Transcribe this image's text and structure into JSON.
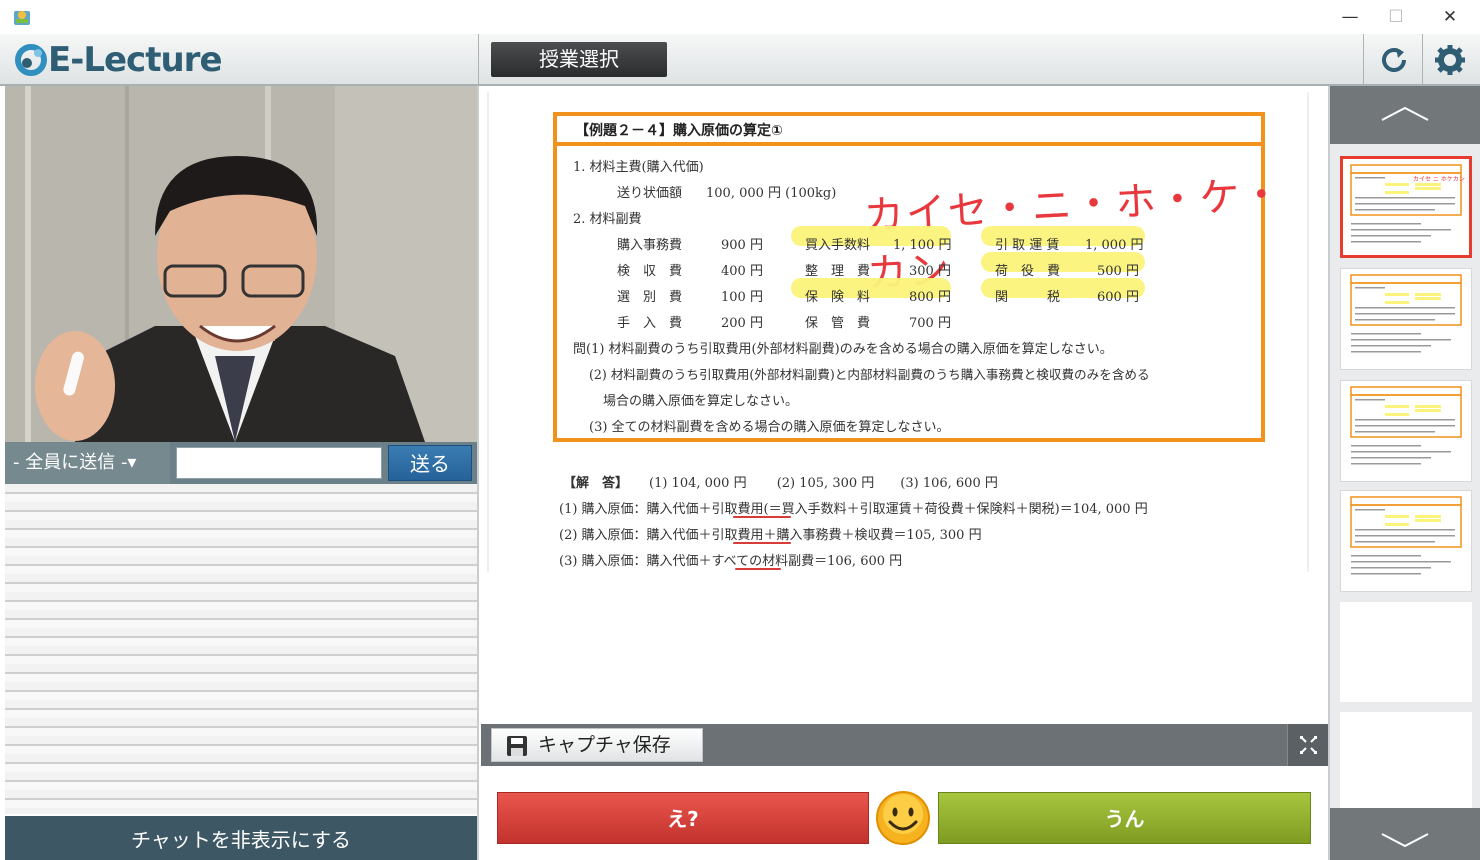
{
  "app": {
    "name": "E-Lecture",
    "lesson_select": "授業選択"
  },
  "chat": {
    "to_all": "- 全員に送信 -▾",
    "input_value": "",
    "send": "送る",
    "hide": "チャットを非表示にする"
  },
  "doc": {
    "title": "【例題２－４】購入原価の算定①",
    "l1": "1.  材料主費(購入代価)",
    "l2a": "送り状価額",
    "l2b": "100, 000 円 (100kg)",
    "l3": "2.  材料副費",
    "rows": [
      [
        "購入事務費",
        "900 円",
        "買入手数料",
        "1, 100 円",
        "引 取 運 賃",
        "1, 000 円"
      ],
      [
        "検　収　費",
        "400 円",
        "整　理　費",
        "300 円",
        "荷　役　費",
        "500 円"
      ],
      [
        "選　別　費",
        "100 円",
        "保　険　料",
        "800 円",
        "関　　　税",
        "600 円"
      ],
      [
        "手　入　費",
        "200 円",
        "保　管　費",
        "700 円",
        "",
        ""
      ]
    ],
    "q1": "問(1)  材料副費のうち引取費用(外部材料副費)のみを含める場合の購入原価を算定しなさい。",
    "q2a": "(2)  材料副費のうち引取費用(外部材料副費)と内部材料副費のうち購入事務費と検収費のみを含める",
    "q2b": "場合の購入原価を算定しなさい。",
    "q3": "(3)  全ての材料副費を含める場合の購入原価を算定しなさい。",
    "handwriting": "カイセ・ニ・ホ・ケ・カン",
    "answer_head": "【解　答】",
    "answer_vals": "(1) 104, 000 円　　 (2) 105, 300 円　　(3) 106, 600 円",
    "a1": "(1)  購入原価：購入代価＋引取費用(＝買入手数料＋引取運賃＋荷役費＋保険料＋関税)＝104, 000 円",
    "a2": "(2)  購入原価：購入代価＋引取費用＋購入事務費＋検収費＝105, 300 円",
    "a3": "(3)  購入原価：購入代価＋すべての材料副費＝106, 600 円"
  },
  "toolbar": {
    "capture": "キャプチャ保存"
  },
  "reactions": {
    "eh": "え?",
    "un": "うん"
  },
  "colors": {
    "accent_orange": "#f0921c",
    "highlight": "#fbf37a",
    "red": "#e63c2f",
    "green": "#8fb02c",
    "header_dark": "#3d5864"
  }
}
